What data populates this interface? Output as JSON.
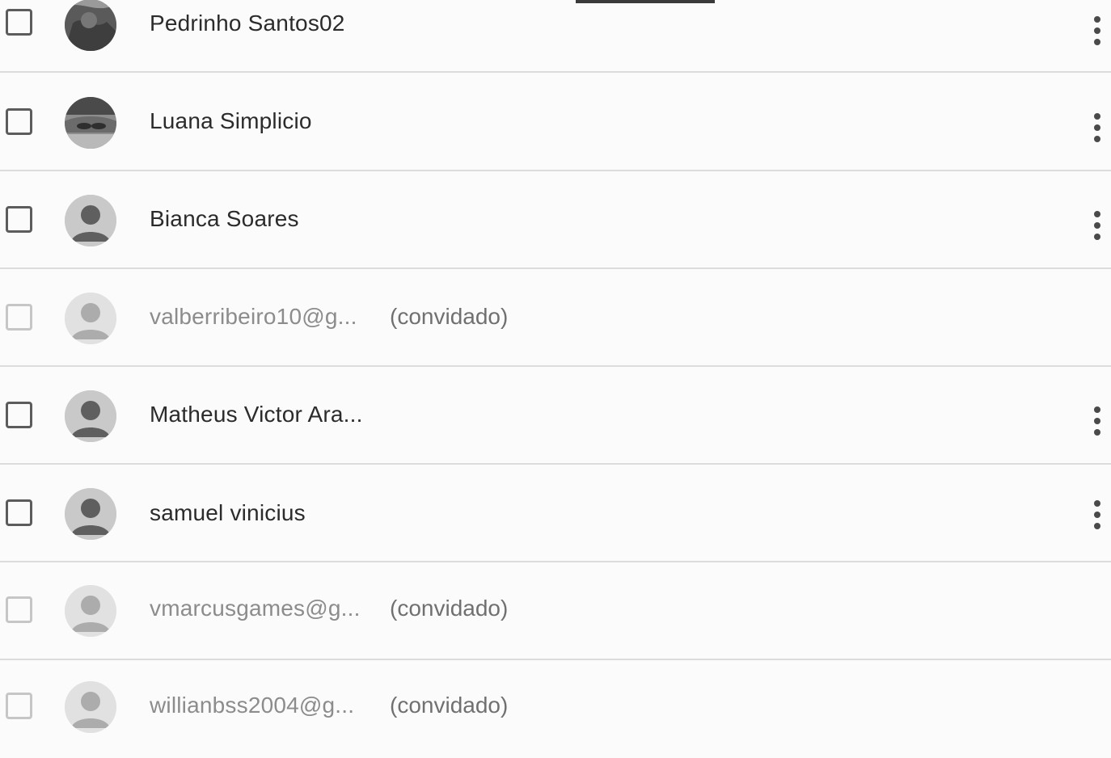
{
  "members": [
    {
      "name": "Pedrinho Santos02",
      "invited": false,
      "avatar": "photo-avatar",
      "has_menu": true
    },
    {
      "name": "Luana Simplicio",
      "invited": false,
      "avatar": "photo-avatar",
      "has_menu": true
    },
    {
      "name": "Bianca Soares",
      "invited": false,
      "avatar": "default-avatar",
      "has_menu": true
    },
    {
      "name": "valberribeiro10@g...",
      "invited": true,
      "invited_label": "(convidado)",
      "avatar": "default-avatar",
      "has_menu": false
    },
    {
      "name": "Matheus Victor Ara...",
      "invited": false,
      "avatar": "default-avatar",
      "has_menu": true
    },
    {
      "name": "samuel vinicius",
      "invited": false,
      "avatar": "default-avatar",
      "has_menu": true
    },
    {
      "name": "vmarcusgames@g...",
      "invited": true,
      "invited_label": "(convidado)",
      "avatar": "default-avatar",
      "has_menu": false
    },
    {
      "name": "willianbss2004@g...",
      "invited": true,
      "invited_label": "(convidado)",
      "avatar": "default-avatar",
      "has_menu": false
    }
  ],
  "icons": {
    "checkbox": "checkbox-icon",
    "more": "more-vert-icon",
    "person": "person-icon"
  },
  "colors": {
    "text_primary": "#2b2b2b",
    "text_invited": "#8c8c8c",
    "divider": "#dcdcdc"
  }
}
